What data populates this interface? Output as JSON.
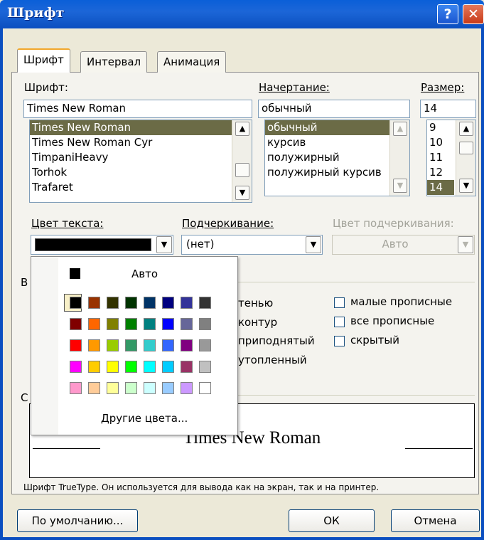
{
  "window": {
    "title": "Шрифт",
    "help_symbol": "?",
    "close_symbol": "✕",
    "title_color": "#0b5ad5"
  },
  "tabs": [
    {
      "label": "Шрифт",
      "active": true
    },
    {
      "label": "Интервал",
      "active": false
    },
    {
      "label": "Анимация",
      "active": false
    }
  ],
  "font": {
    "label": "Шрифт:",
    "value": "Times New Roman",
    "list": [
      "Times New Roman",
      "Times New Roman Cyr",
      "TimpaniHeavy",
      "Torhok",
      "Trafaret"
    ],
    "selected_index": 0
  },
  "style": {
    "label": "Начертание:",
    "value": "обычный",
    "list": [
      "обычный",
      "курсив",
      "полужирный",
      "полужирный курсив"
    ],
    "selected_index": 0
  },
  "size": {
    "label": "Размер:",
    "value": "14",
    "list": [
      "9",
      "10",
      "11",
      "12",
      "14"
    ],
    "selected_index": 4
  },
  "text_color": {
    "label": "Цвет текста:",
    "value_color": "#000000"
  },
  "underline": {
    "label": "Подчеркивание:",
    "value": "(нет)"
  },
  "underline_color": {
    "label": "Цвет подчеркивания:",
    "value": "Авто",
    "disabled": true
  },
  "effects_group_partial": "В",
  "effects_left_partial": [
    "тенью",
    "контур",
    "приподнятый",
    "утопленный"
  ],
  "effects_right": [
    {
      "label": "малые прописные",
      "checked": false
    },
    {
      "label": "все прописные",
      "checked": false
    },
    {
      "label": "скрытый",
      "checked": false
    }
  ],
  "sample_group_partial": "С",
  "preview": {
    "text": "Times New Roman",
    "note": "Шрифт TrueType. Он используется для вывода как на экран, так и на принтер."
  },
  "buttons": {
    "default": "По умолчанию...",
    "ok": "ОК",
    "cancel": "Отмена"
  },
  "color_popup": {
    "auto_label": "Авто",
    "more_label": "Другие цвета...",
    "palette": [
      [
        "#000000",
        "#993300",
        "#333300",
        "#003300",
        "#003366",
        "#000080",
        "#333399",
        "#333333"
      ],
      [
        "#800000",
        "#ff6600",
        "#808000",
        "#008000",
        "#008080",
        "#0000ff",
        "#666699",
        "#808080"
      ],
      [
        "#ff0000",
        "#ff9900",
        "#99cc00",
        "#339966",
        "#33cccc",
        "#3366ff",
        "#800080",
        "#999999"
      ],
      [
        "#ff00ff",
        "#ffcc00",
        "#ffff00",
        "#00ff00",
        "#00ffff",
        "#00ccff",
        "#993366",
        "#c0c0c0"
      ],
      [
        "#ff99cc",
        "#ffcc99",
        "#ffff99",
        "#ccffcc",
        "#ccffff",
        "#99ccff",
        "#cc99ff",
        "#ffffff"
      ]
    ]
  }
}
